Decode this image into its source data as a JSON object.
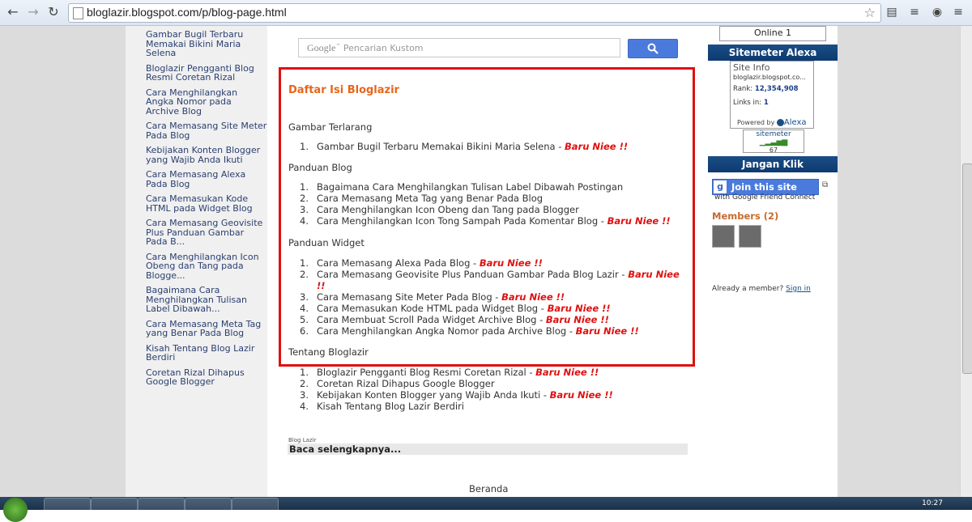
{
  "browser": {
    "url": "bloglazir.blogspot.com/p/blog-page.html"
  },
  "sidebar_left": {
    "posts": [
      "Gambar Bugil Terbaru Memakai Bikini Maria Selena",
      "Bloglazir Pengganti Blog Resmi Coretan Rizal",
      "Cara Menghilangkan Angka Nomor pada Archive Blog",
      "Cara Memasang Site Meter Pada Blog",
      "Kebijakan Konten Blogger yang Wajib Anda Ikuti",
      "Cara Memasang Alexa Pada Blog",
      "Cara Memasukan Kode HTML pada Widget Blog",
      "Cara Memasang Geovisite Plus Panduan Gambar Pada B...",
      "Cara Menghilangkan Icon Obeng dan Tang pada Blogge...",
      "Bagaimana Cara Menghilangkan Tulisan Label Dibawah...",
      "Cara Memasang Meta Tag yang Benar Pada Blog",
      "Kisah Tentang Blog Lazir Berdiri",
      "Coretan Rizal Dihapus Google Blogger"
    ]
  },
  "search": {
    "google_word": "Google",
    "placeholder": "Pencarian Kustom",
    "button_icon": "search-icon"
  },
  "toc": {
    "title": "Daftar Isi Bloglazir",
    "new_tag": "Baru Niee !!",
    "sections": [
      {
        "heading": "Gambar Terlarang",
        "items": [
          {
            "num": "1.",
            "text": "Gambar Bugil Terbaru Memakai Bikini Maria Selena - ",
            "new": "Baru Niee !!"
          }
        ]
      },
      {
        "heading": "Panduan Blog",
        "items": [
          {
            "num": "1.",
            "text": "Bagaimana Cara Menghilangkan Tulisan Label Dibawah Postingan",
            "new": ""
          },
          {
            "num": "2.",
            "text": "Cara Memasang Meta Tag yang Benar Pada Blog",
            "new": ""
          },
          {
            "num": "3.",
            "text": "Cara Menghilangkan Icon Obeng dan Tang pada Blogger",
            "new": ""
          },
          {
            "num": "4.",
            "text": "Cara Menghilangkan Icon Tong Sampah Pada Komentar Blog - ",
            "new": "Baru Niee !!"
          }
        ]
      },
      {
        "heading": "Panduan Widget",
        "items": [
          {
            "num": "1.",
            "text": "Cara Memasang Alexa Pada Blog - ",
            "new": "Baru Niee !!"
          },
          {
            "num": "2.",
            "text": "Cara Memasang Geovisite Plus Panduan Gambar Pada Blog Lazir - ",
            "new": "Baru Niee !!"
          },
          {
            "num": "3.",
            "text": "Cara Memasang Site Meter Pada Blog - ",
            "new": "Baru Niee !!"
          },
          {
            "num": "4.",
            "text": "Cara Memasukan Kode HTML pada Widget Blog - ",
            "new": "Baru Niee !!"
          },
          {
            "num": "5.",
            "text": "Cara Membuat Scroll Pada Widget Archive Blog - ",
            "new": "Baru Niee !!"
          },
          {
            "num": "6.",
            "text": "Cara Menghilangkan Angka Nomor pada Archive Blog - ",
            "new": "Baru Niee !!"
          }
        ]
      },
      {
        "heading": "Tentang Bloglazir",
        "items": [
          {
            "num": "1.",
            "text": "Bloglazir Pengganti Blog Resmi Coretan Rizal - ",
            "new": "Baru Niee !!"
          },
          {
            "num": "2.",
            "text": "Coretan Rizal Dihapus Google Blogger",
            "new": ""
          },
          {
            "num": "3.",
            "text": "Kebijakan Konten Blogger yang Wajib Anda Ikuti - ",
            "new": "Baru Niee !!"
          },
          {
            "num": "4.",
            "text": "Kisah Tentang Blog Lazir Berdiri",
            "new": ""
          }
        ]
      }
    ]
  },
  "footer": {
    "blog_label": "Blog Lazir",
    "read_more": "Baca selengkapnya...",
    "home_link": "Beranda"
  },
  "sidebar_right": {
    "online": "Online 1",
    "sitemeter_head": "Sitemeter Alexa",
    "alexa": {
      "heading": "Site Info",
      "site": "bloglazir.blogspot.co...",
      "rank_label": "Rank:",
      "rank_value": "12,354,908",
      "links_label": "Links in:",
      "links_value": "1",
      "powered": "Powered by",
      "brand": "Alexa"
    },
    "sitemeter": {
      "label": "sitemeter",
      "count": "67"
    },
    "jangan_head": "Jangan Klik",
    "gfc": {
      "button": "Join this site",
      "sub": "with Google Friend Connect"
    },
    "members": "Members (2)",
    "already": "Already a member?",
    "signin": "Sign in"
  },
  "taskbar": {
    "clock": "10:27"
  }
}
